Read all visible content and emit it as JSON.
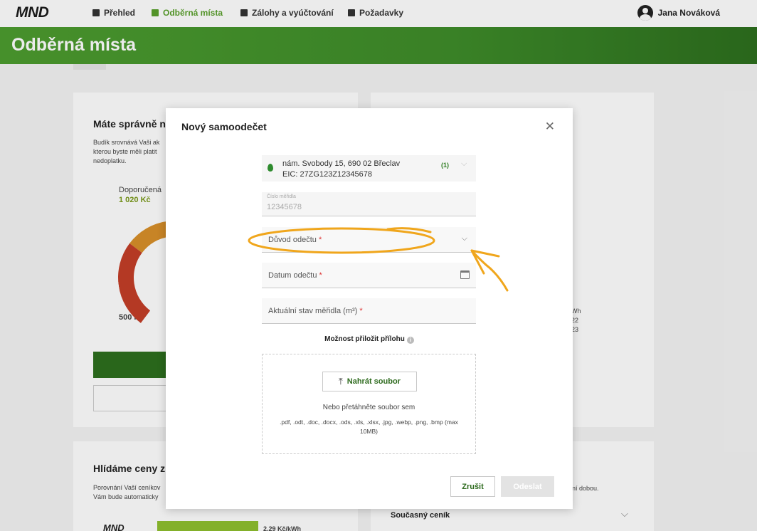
{
  "nav": {
    "logo": "MND",
    "items": [
      {
        "label": "Přehled",
        "active": false
      },
      {
        "label": "Odběrná místa",
        "active": true
      },
      {
        "label": "Zálohy a vyúčtování",
        "active": false
      },
      {
        "label": "Požadavky",
        "active": false
      }
    ],
    "user_name": "Jana Nováková"
  },
  "banner": {
    "title": "Odběrná místa"
  },
  "background": {
    "card1_title": "Máte správně n",
    "card1_text_lines": [
      "Budík srovnává Vaši ak",
      "kterou byste měli platit",
      "nedoplatku."
    ],
    "gauge_label": "Doporučená",
    "gauge_value": "1 020 Kč",
    "gauge_min": "500 Kč",
    "card2_title": "Hlídáme ceny z",
    "card2_text_lines": [
      "Porovnání Vaší ceníkov",
      "Vám bude automaticky"
    ],
    "right_text_1": "Wh",
    "right_text_2": "22",
    "right_text_3": "23",
    "right_partial": "ní dobou.",
    "current_tariff": "Současný ceník",
    "bottom_logo": "MND",
    "bottom_price": "2.29 Kč/kWh"
  },
  "modal": {
    "title": "Nový samoodečet",
    "close_icon": "close-icon",
    "place": {
      "address": "nám. Svobody 15, 690 02 Břeclav",
      "eic": "EIC: 27ZG123Z12345678",
      "count": "(1)"
    },
    "meter": {
      "label": "Číslo měřidla",
      "value": "12345678"
    },
    "reason": {
      "label": "Důvod odečtu",
      "required": "*"
    },
    "date": {
      "label": "Datum odečtu",
      "required": "*"
    },
    "state": {
      "label": "Aktuální stav měřidla (m³)",
      "required": "*"
    },
    "attachment_title": "Možnost přiložit přílohu",
    "upload_button": "Nahrát soubor",
    "drop_hint": "Nebo přetáhněte soubor sem",
    "formats": ".pdf, .odt, .doc, .docx, .ods, .xls, .xlsx, .jpg, .webp, .png, .bmp (max 10MB)",
    "cancel_button": "Zrušit",
    "send_button": "Odeslat"
  },
  "colors": {
    "brand_green": "#4d9d2f",
    "annotation_orange": "#f0a61c"
  }
}
